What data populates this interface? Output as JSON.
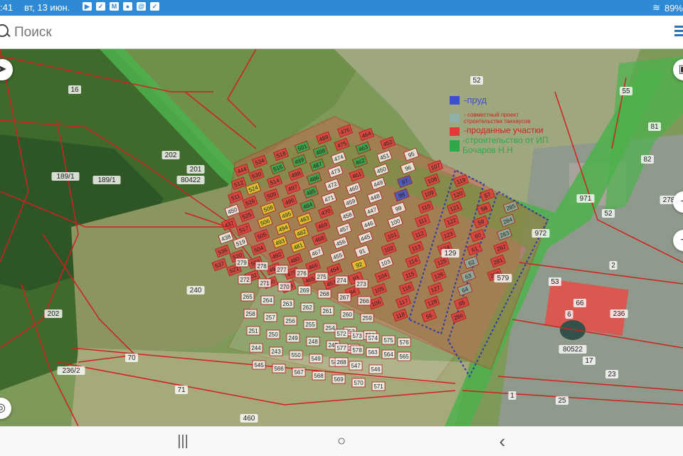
{
  "statusbar": {
    "time": ":41",
    "date": "вт, 13 июн.",
    "battery": "89%"
  },
  "search": {
    "placeholder": "Поиск"
  },
  "legend": [
    {
      "text": "-пруд",
      "color": "#3e4fd0"
    },
    {
      "text": "- совместный проект строительства танхаусов",
      "color": "#8fb0a8"
    },
    {
      "text": "-проданные участки",
      "color": "#e23a3a"
    },
    {
      "text": "-строительство от ИП Бочаров Н.Н",
      "color": "#2fa84a"
    }
  ],
  "map_labels": {
    "big": [
      "16",
      "202",
      "201",
      "80422",
      "189/1",
      "189/1",
      "240",
      "202",
      "70",
      "71",
      "460",
      "52",
      "55",
      "81",
      "82",
      "278",
      "52",
      "2",
      "66",
      "6",
      "80522",
      "17",
      "236",
      "236/2",
      "1",
      "25",
      "23",
      "53",
      "972",
      "971",
      "579",
      "129"
    ],
    "parcels": [
      "444",
      "512",
      "511",
      "450",
      "437",
      "438",
      "536",
      "537",
      "534",
      "530",
      "524",
      "526",
      "525",
      "517",
      "519",
      "520",
      "521",
      "518",
      "516",
      "514",
      "509",
      "508",
      "506",
      "505",
      "504",
      "503",
      "502",
      "501",
      "499",
      "498",
      "497",
      "496",
      "495",
      "494",
      "493",
      "492",
      "491",
      "490",
      "489",
      "488",
      "487",
      "486",
      "485",
      "484",
      "483",
      "482",
      "481",
      "480",
      "479",
      "478",
      "476",
      "475",
      "474",
      "473",
      "472",
      "471",
      "470",
      "469",
      "468",
      "467",
      "466",
      "465",
      "464",
      "463",
      "462",
      "461",
      "460",
      "459",
      "458",
      "457",
      "456",
      "455",
      "454",
      "453",
      "452",
      "451",
      "450",
      "449",
      "448",
      "447",
      "446",
      "445",
      "91",
      "92",
      "93",
      "94",
      "95",
      "96",
      "97",
      "98",
      "99",
      "100",
      "101",
      "102",
      "103",
      "104",
      "105",
      "106",
      "107",
      "108",
      "109",
      "110",
      "111",
      "112",
      "113",
      "114",
      "115",
      "116",
      "117",
      "118",
      "119",
      "120",
      "121",
      "122",
      "123",
      "124",
      "125",
      "126",
      "127",
      "128",
      "56",
      "57",
      "58",
      "59",
      "60",
      "61",
      "62",
      "63",
      "64",
      "65",
      "286",
      "285",
      "284",
      "283",
      "282",
      "281",
      "280",
      "279",
      "278",
      "277",
      "276",
      "275",
      "274",
      "273",
      "272",
      "271",
      "270",
      "269",
      "268",
      "267",
      "266",
      "265",
      "264",
      "263",
      "262",
      "261",
      "260",
      "259",
      "258",
      "257",
      "256",
      "255",
      "254",
      "253",
      "252",
      "251",
      "250",
      "249",
      "248",
      "247",
      "246",
      "245",
      "244",
      "243",
      "550",
      "549",
      "548",
      "547",
      "546",
      "545",
      "566",
      "567",
      "568",
      "569",
      "570",
      "571",
      "572",
      "573",
      "574",
      "575",
      "576",
      "577",
      "578",
      "563",
      "564",
      "565",
      "288"
    ]
  },
  "controls": {
    "layers_icon": "layers-icon",
    "zoom_in": "+",
    "zoom_out": "−",
    "locate_icon": "locate-icon",
    "back_icon": "navigation-icon"
  },
  "navbar": {
    "recents": "|||",
    "home": "○",
    "back": "‹"
  }
}
